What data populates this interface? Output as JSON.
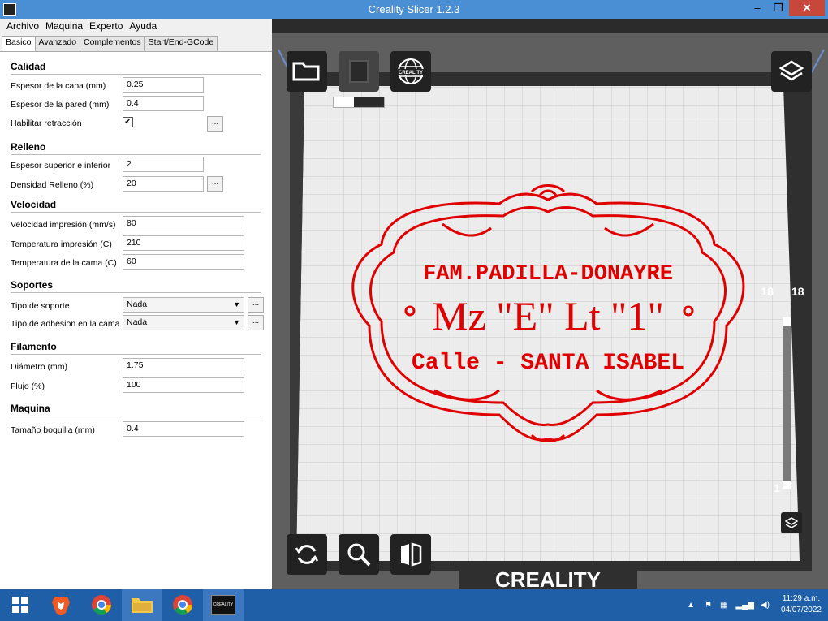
{
  "window": {
    "title": "Creality Slicer 1.2.3",
    "min": "–",
    "max": "❐",
    "close": "✕"
  },
  "menu": [
    "Archivo",
    "Maquina",
    "Experto",
    "Ayuda"
  ],
  "tabs": [
    "Basico",
    "Avanzado",
    "Complementos",
    "Start/End-GCode"
  ],
  "sections": {
    "calidad": "Calidad",
    "relleno": "Relleno",
    "velocidad": "Velocidad",
    "soportes": "Soportes",
    "filamento": "Filamento",
    "maquina": "Maquina"
  },
  "fields": {
    "layer_h": {
      "label": "Espesor de la capa (mm)",
      "value": "0.25"
    },
    "wall": {
      "label": "Espesor de la pared (mm)",
      "value": "0.4"
    },
    "retract": {
      "label": "Habilitar retracción",
      "value": "✓"
    },
    "topbot": {
      "label": "Espesor superior e inferior",
      "value": "2"
    },
    "infill": {
      "label": "Densidad Relleno (%)",
      "value": "20"
    },
    "speed": {
      "label": "Velocidad impresión (mm/s)",
      "value": "80"
    },
    "temp": {
      "label": "Temperatura impresión (C)",
      "value": "210"
    },
    "bed": {
      "label": "Temperatura de la cama (C)",
      "value": "60"
    },
    "support": {
      "label": "Tipo de soporte",
      "value": "Nada"
    },
    "adhesion": {
      "label": "Tipo de adhesion en la cama",
      "value": "Nada"
    },
    "diameter": {
      "label": "Diámetro (mm)",
      "value": "1.75"
    },
    "flow": {
      "label": "Flujo (%)",
      "value": "100"
    },
    "nozzle": {
      "label": "Tamaño boquilla (mm)",
      "value": "0.4"
    }
  },
  "dots": "...",
  "model": {
    "line1": "FAM.PADILLA-DONAYRE",
    "line2": "Mz \"E\" Lt \"1\"",
    "line3": "Calle - SANTA ISABEL",
    "color": "#e00000"
  },
  "layer_slider": {
    "top": "18",
    "top2": "18",
    "bottom": "1"
  },
  "brand": "CREALITY",
  "logo_text": "CREALITY",
  "tray": {
    "time": "11:29 a.m.",
    "date": "04/07/2022"
  },
  "taskbar_app_label": "CREALITY"
}
